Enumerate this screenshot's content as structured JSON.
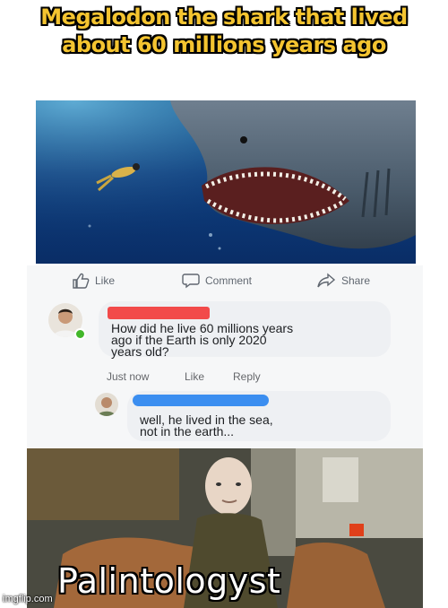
{
  "caption": {
    "line1": "Megalodon the shark that lived",
    "line2": "about 60 millions years ago"
  },
  "post": {
    "actions": {
      "like_label": "Like",
      "comment_label": "Comment",
      "share_label": "Share"
    }
  },
  "comments": [
    {
      "text_line1": "How did he live 60 millions years",
      "text_line2": "ago if the Earth is only 2020",
      "text_line3": "years old?",
      "time": "Just now",
      "like_label": "Like",
      "reply_label": "Reply"
    },
    {
      "text_line1": "well, he lived in the sea,",
      "text_line2": "not in the earth..."
    }
  ],
  "meme": {
    "word": "Palintologyst"
  },
  "watermark": "imgflip.com",
  "colors": {
    "caption_fill": "#f4c430",
    "redaction_red": "#f24a4a",
    "redaction_blue": "#3b8ef0",
    "online_green": "#42b72a",
    "link_gray": "#65676b"
  },
  "icons": [
    "thumbs-up-icon",
    "speech-bubble-icon",
    "share-arrow-icon"
  ]
}
